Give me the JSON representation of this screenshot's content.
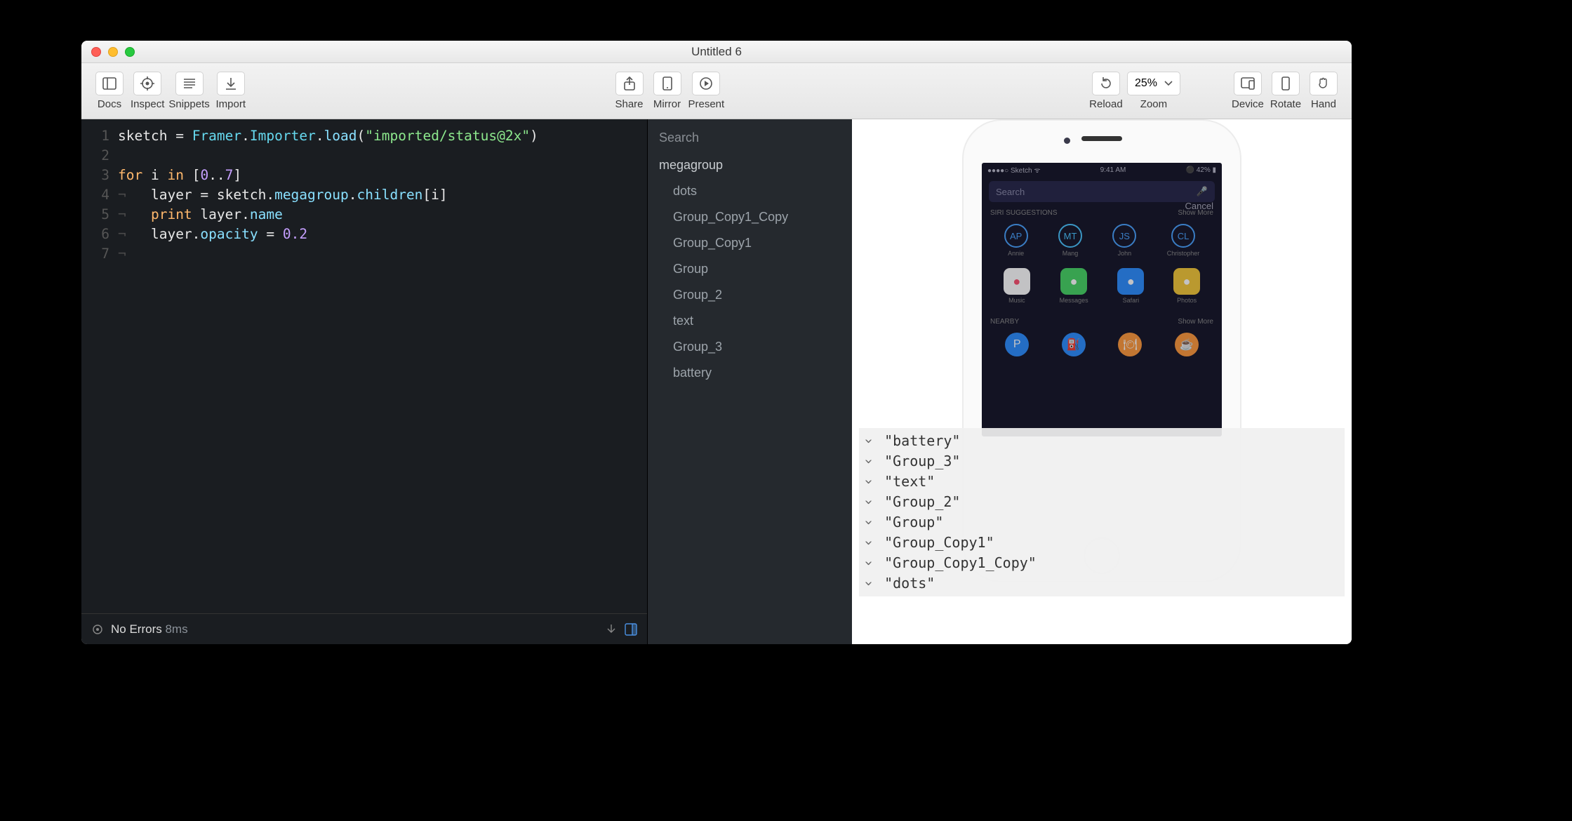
{
  "window": {
    "title": "Untitled 6"
  },
  "toolbar": {
    "docs": "Docs",
    "inspect": "Inspect",
    "snippets": "Snippets",
    "import": "Import",
    "share": "Share",
    "mirror": "Mirror",
    "present": "Present",
    "reload": "Reload",
    "zoom": "Zoom",
    "zoom_value": "25%",
    "device": "Device",
    "rotate": "Rotate",
    "hand": "Hand"
  },
  "code": {
    "lines": [
      "1",
      "2",
      "3",
      "4",
      "5",
      "6",
      "7"
    ]
  },
  "code_tokens": {
    "l1_a": "sketch",
    "l1_b": " = ",
    "l1_c": "Framer",
    "l1_d": ".",
    "l1_e": "Importer",
    "l1_f": ".",
    "l1_g": "load",
    "l1_h": "(",
    "l1_i": "\"imported/status@2x\"",
    "l1_j": ")",
    "l3_a": "for",
    "l3_b": " i ",
    "l3_c": "in",
    "l3_d": " [",
    "l3_e": "0",
    "l3_f": "..",
    "l3_g": "7",
    "l3_h": "]",
    "l4_ind": "¬   ",
    "l4_a": "layer",
    "l4_b": " = sketch.",
    "l4_c": "megagroup",
    "l4_d": ".",
    "l4_e": "children",
    "l4_f": "[i]",
    "l5_ind": "¬   ",
    "l5_a": "print",
    "l5_b": " layer.",
    "l5_c": "name",
    "l6_ind": "¬   ",
    "l6_a": "layer.",
    "l6_b": "opacity",
    "l6_c": " = ",
    "l6_d": "0.2",
    "l7_ind": "¬"
  },
  "status": {
    "errors": "No Errors",
    "ms": "8ms"
  },
  "layers": {
    "search": "Search",
    "root": "megagroup",
    "children": [
      "dots",
      "Group_Copy1_Copy",
      "Group_Copy1",
      "Group",
      "Group_2",
      "text",
      "Group_3",
      "battery"
    ]
  },
  "console": [
    "\"battery\"",
    "\"Group_3\"",
    "\"text\"",
    "\"Group_2\"",
    "\"Group\"",
    "\"Group_Copy1\"",
    "\"Group_Copy1_Copy\"",
    "\"dots\""
  ],
  "phone": {
    "carrier": "Sketch",
    "time": "9:41 AM",
    "battery": "42%",
    "search": "Search",
    "cancel": "Cancel",
    "siri_title": "SIRI SUGGESTIONS",
    "show_more": "Show More",
    "contacts": [
      {
        "initials": "AP",
        "name": "Annie",
        "color": "#4aa3ff"
      },
      {
        "initials": "MT",
        "name": "Mang",
        "color": "#4ac5ff"
      },
      {
        "initials": "JS",
        "name": "John",
        "color": "#4aa3ff"
      },
      {
        "initials": "CL",
        "name": "Christopher",
        "color": "#4aa3ff"
      }
    ],
    "apps": [
      {
        "name": "Music",
        "color": "#fc5070",
        "bg": "#fff"
      },
      {
        "name": "Messages",
        "color": "#fff",
        "bg": "#47d465"
      },
      {
        "name": "Safari",
        "color": "#fff",
        "bg": "#2d8eff"
      },
      {
        "name": "Photos",
        "color": "#fff",
        "bg": "#f5c838"
      }
    ],
    "nearby_title": "NEARBY",
    "nearby": [
      {
        "label": "P",
        "bg": "#2d8eff"
      },
      {
        "label": "⛽",
        "bg": "#2d8eff"
      },
      {
        "label": "🍽",
        "bg": "#ff9a3c"
      },
      {
        "label": "☕",
        "bg": "#ff9a3c"
      }
    ]
  }
}
